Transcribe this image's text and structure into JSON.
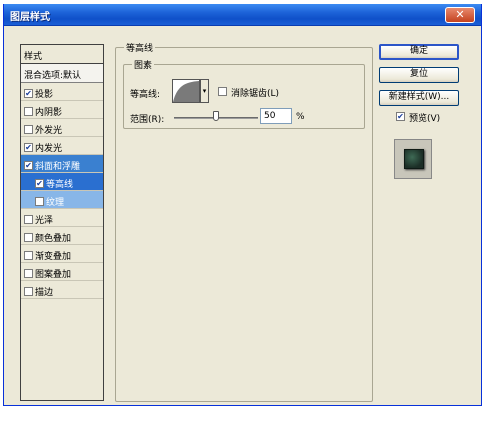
{
  "window": {
    "title": "图层样式",
    "close_icon": "close-icon"
  },
  "style_list": {
    "header": "样式",
    "blend_options": "混合选项:默认",
    "items": [
      {
        "label": "投影",
        "checked": true
      },
      {
        "label": "内阴影",
        "checked": false
      },
      {
        "label": "外发光",
        "checked": false
      },
      {
        "label": "内发光",
        "checked": true
      },
      {
        "label": "斜面和浮雕",
        "checked": true,
        "selected": true
      },
      {
        "label": "等高线",
        "checked": true,
        "sub": true,
        "active": true
      },
      {
        "label": "纹理",
        "checked": false,
        "sub": true
      },
      {
        "label": "光泽",
        "checked": false
      },
      {
        "label": "颜色叠加",
        "checked": false
      },
      {
        "label": "渐变叠加",
        "checked": false
      },
      {
        "label": "图案叠加",
        "checked": false
      },
      {
        "label": "描边",
        "checked": false
      }
    ]
  },
  "contour_panel": {
    "group_title": "等高线",
    "subgroup_title": "图素",
    "contour_label": "等高线:",
    "antialias_label": "消除锯齿(L)",
    "antialias_checked": false,
    "range_label": "范围(R):",
    "range_value": "50",
    "range_unit": "%",
    "range_fraction": 0.5
  },
  "buttons": {
    "ok": "确定",
    "reset": "复位",
    "new_style": "新建样式(W)...",
    "preview_label": "预览(V)",
    "preview_checked": true
  }
}
